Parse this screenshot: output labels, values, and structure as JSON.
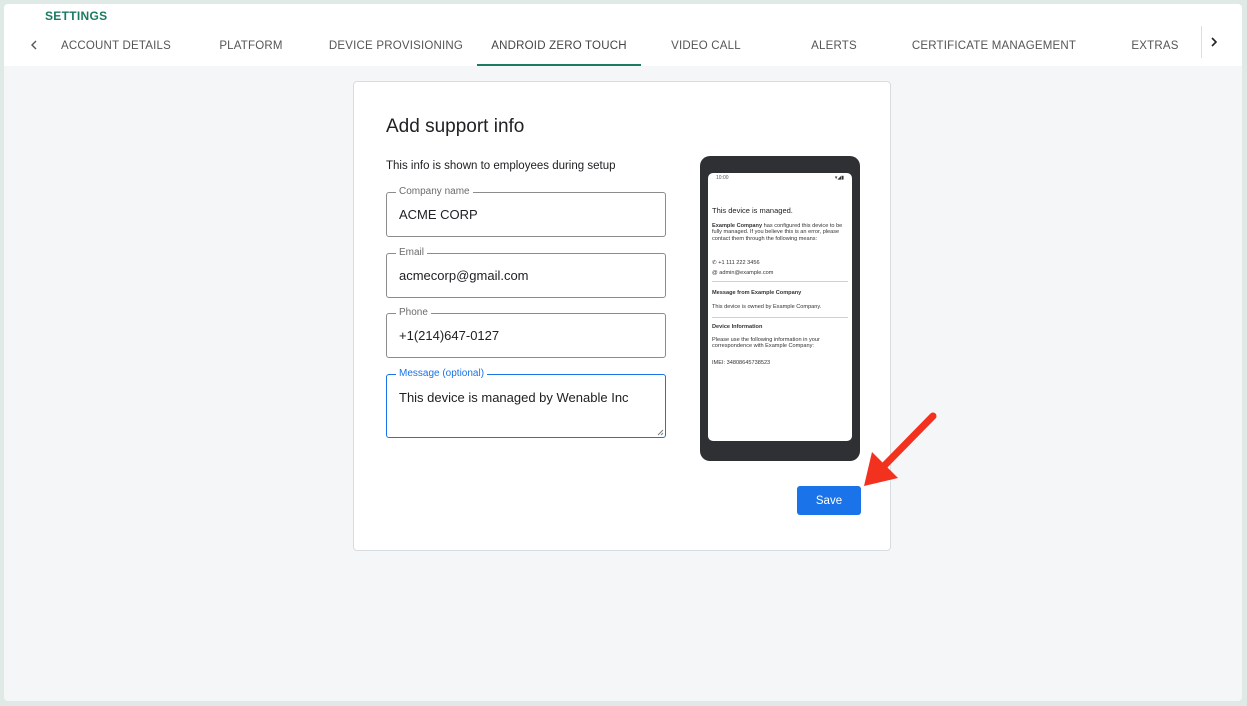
{
  "header": {
    "section_title": "SETTINGS",
    "tabs": [
      {
        "label": "ACCOUNT DETAILS",
        "active": false
      },
      {
        "label": "PLATFORM",
        "active": false
      },
      {
        "label": "DEVICE PROVISIONING",
        "active": false
      },
      {
        "label": "ANDROID ZERO TOUCH",
        "active": true
      },
      {
        "label": "VIDEO CALL",
        "active": false
      },
      {
        "label": "ALERTS",
        "active": false
      },
      {
        "label": "CERTIFICATE MANAGEMENT",
        "active": false
      },
      {
        "label": "EXTRAS",
        "active": false
      }
    ]
  },
  "card": {
    "title": "Add support info",
    "subtitle": "This info is shown to employees during setup",
    "fields": {
      "company": {
        "label": "Company name",
        "value": "ACME CORP"
      },
      "email": {
        "label": "Email",
        "value": "acmecorp@gmail.com"
      },
      "phone": {
        "label": "Phone",
        "value": "+1(214)647-0127"
      },
      "message": {
        "label": "Message (optional)",
        "value": "This device is managed by Wenable Inc"
      }
    },
    "save_label": "Save"
  },
  "preview": {
    "status_time": "10:00",
    "title": "This device is managed.",
    "company_bold": "Example Company",
    "body": "has configured this device to be fully managed. If you believe this is an error, please contact them through the following means:",
    "phone": "+1 111 222 3456",
    "email": "admin@example.com",
    "message_heading": "Message from Example Company",
    "message_body": "This device is owned by Example Company.",
    "info_heading": "Device Information",
    "info_body": "Please use the following information in your correspondence with Example Company:",
    "imei": "IMEI: 348086457385​23"
  },
  "colors": {
    "accent": "#1b7a63",
    "button": "#1a73e8",
    "annotation_arrow": "#f2311f"
  }
}
